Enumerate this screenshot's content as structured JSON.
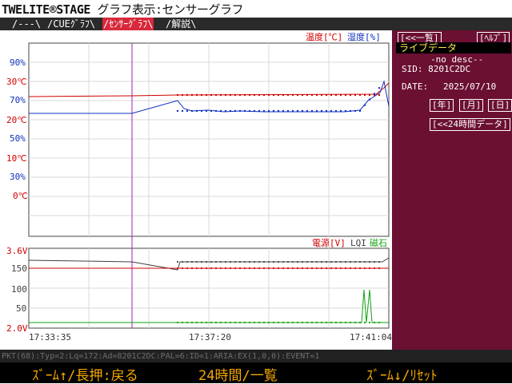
{
  "title": {
    "brand": "TWELITE®STAGE",
    "subtitle": "グラフ表示:センサーグラフ"
  },
  "tabs": [
    {
      "label": "/---\\"
    },
    {
      "label": "/CUEｸﾞﾗﾌ\\"
    },
    {
      "label": "/ｾﾝｻｰｸﾞﾗﾌ\\"
    },
    {
      "label": "/解説\\"
    }
  ],
  "sidebar": {
    "back_button": "[<<一覧]",
    "help_button": "[ﾍﾙﾌﾟ]",
    "live_title": "ライブデータ",
    "desc": "-no desc--",
    "sid_label": "SID: 8201C2DC",
    "date_label": "DATE:",
    "date_value": "2025/07/10",
    "year_button": "[年]",
    "month_button": "[月]",
    "day_button": "[日]",
    "h24_button": "[<<24時間データ]"
  },
  "upper_legend": {
    "temp": "温度[℃]",
    "hum": "湿度[%]"
  },
  "lower_legend": {
    "volt": "電源[V]",
    "lqi": "LQI",
    "mag": "磁石"
  },
  "upper_ticks_hum": [
    "90%",
    "70%",
    "50%",
    "30%"
  ],
  "upper_ticks_temp": [
    "30℃",
    "20℃",
    "10℃",
    "0℃"
  ],
  "lower_ticks": [
    "3.6V",
    "150",
    "100",
    "50",
    "2.0V"
  ],
  "time_labels": [
    "17:33:35",
    "17:37:20",
    "17:41:04"
  ],
  "status": {
    "pkt": "PKT(68):Typ=2:Lq=172:Ad=8201C2DC:PAL=6:ID=1:ARIA:EX(1,0,0):EVENT=1"
  },
  "footer": {
    "left": "ｽﾞｰﾑ↑/長押:戻る",
    "center": "24時間/一覧",
    "right": "ｽﾞｰﾑ↓/ﾘｾｯﾄ"
  },
  "colors": {
    "temp": "#d00000",
    "hum": "#1030c0",
    "volt": "#d00000",
    "lqi": "#404040",
    "mag": "#10a010",
    "cursor": "#a020c0",
    "sidebar": "#6b0f33",
    "footer_text": "#f5a800"
  }
}
